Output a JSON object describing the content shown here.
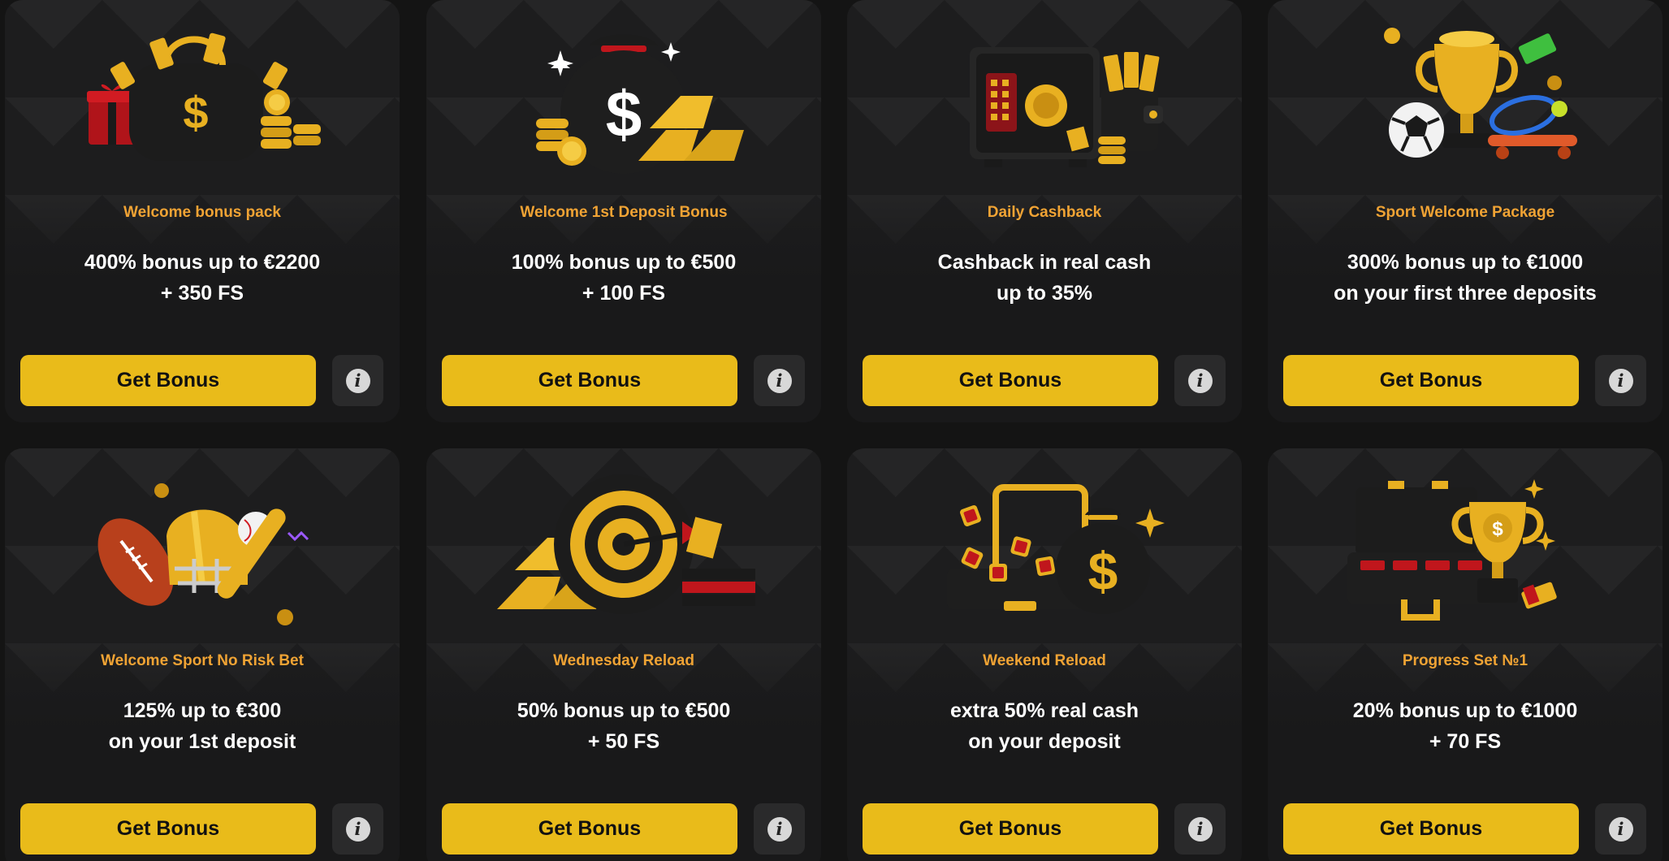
{
  "cards": [
    {
      "title": "Welcome bonus pack",
      "line1": "400% bonus up to €2200",
      "line2": "+ 350 FS",
      "button": "Get Bonus",
      "info": "i",
      "illustration": "gift-bag-coins-icon"
    },
    {
      "title": "Welcome 1st Deposit Bonus",
      "line1": "100% bonus up to €500",
      "line2": "+ 100 FS",
      "button": "Get Bonus",
      "info": "i",
      "illustration": "money-bag-gold-bars-icon"
    },
    {
      "title": "Daily Cashback",
      "line1": "Cashback in real cash",
      "line2": "up to 35%",
      "button": "Get Bonus",
      "info": "i",
      "illustration": "safe-wallet-icon"
    },
    {
      "title": "Sport Welcome Package",
      "line1": "300% bonus up to €1000",
      "line2": "on your first three deposits",
      "button": "Get Bonus",
      "info": "i",
      "illustration": "trophy-sports-icon"
    },
    {
      "title": "Welcome Sport No Risk Bet",
      "line1": "125% up to €300",
      "line2": "on your 1st deposit",
      "button": "Get Bonus",
      "info": "i",
      "illustration": "football-helmet-bat-icon"
    },
    {
      "title": "Wednesday Reload",
      "line1": "50% bonus up to €500",
      "line2": "+ 50 FS",
      "button": "Get Bonus",
      "info": "i",
      "illustration": "target-gold-bars-icon"
    },
    {
      "title": "Weekend Reload",
      "line1": "extra 50% real cash",
      "line2": "on your deposit",
      "button": "Get Bonus",
      "info": "i",
      "illustration": "suitcase-money-bag-icon"
    },
    {
      "title": "Progress Set №1",
      "line1": "20% bonus up to €1000",
      "line2": "+ 70 FS",
      "button": "Get Bonus",
      "info": "i",
      "illustration": "briefcase-trophy-icon"
    }
  ],
  "colors": {
    "page_bg": "#141414",
    "card_bg": "#1d1d1e",
    "title": "#f0a334",
    "button": "#e9bb1a",
    "gold": "#e8b021",
    "dark_object": "#1a1a1a"
  }
}
